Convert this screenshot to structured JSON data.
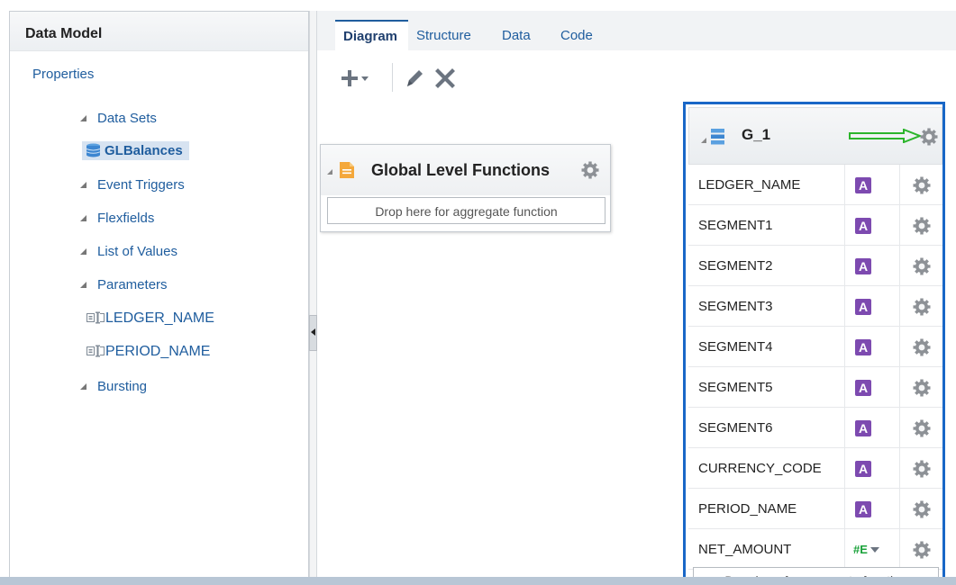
{
  "left_panel": {
    "title": "Data Model",
    "properties_label": "Properties",
    "tree": {
      "data_sets": "Data Sets",
      "glbalances": "GLBalances",
      "event_triggers": "Event Triggers",
      "flexfields": "Flexfields",
      "list_of_values": "List of Values",
      "parameters": "Parameters",
      "param_ledger": "LEDGER_NAME",
      "param_period": "PERIOD_NAME",
      "bursting": "Bursting"
    }
  },
  "tabs": [
    "Diagram",
    "Structure",
    "Data",
    "Code"
  ],
  "active_tab": "Diagram",
  "toolbar": {
    "add_icon": "plus-dropdown-icon",
    "edit_icon": "pencil-icon",
    "delete_icon": "x-icon"
  },
  "global_functions": {
    "title": "Global Level Functions",
    "drop_text": "Drop here for aggregate function"
  },
  "group": {
    "title": "G_1",
    "rows": [
      {
        "name": "LEDGER_NAME",
        "type": "A"
      },
      {
        "name": "SEGMENT1",
        "type": "A"
      },
      {
        "name": "SEGMENT2",
        "type": "A"
      },
      {
        "name": "SEGMENT3",
        "type": "A"
      },
      {
        "name": "SEGMENT4",
        "type": "A"
      },
      {
        "name": "SEGMENT5",
        "type": "A"
      },
      {
        "name": "SEGMENT6",
        "type": "A"
      },
      {
        "name": "CURRENCY_CODE",
        "type": "A"
      },
      {
        "name": "PERIOD_NAME",
        "type": "A"
      },
      {
        "name": "NET_AMOUNT",
        "type": "#E"
      }
    ],
    "drop_text": "Drop here for aggregate function"
  },
  "colors": {
    "link_blue": "#1f5d9e",
    "group_border": "#1967c7",
    "type_a_purple": "#7d4ab0",
    "type_n_green": "#1aa23a",
    "annotation_arrow": "#2bb52b",
    "selection_bg": "#d7e3f1"
  }
}
